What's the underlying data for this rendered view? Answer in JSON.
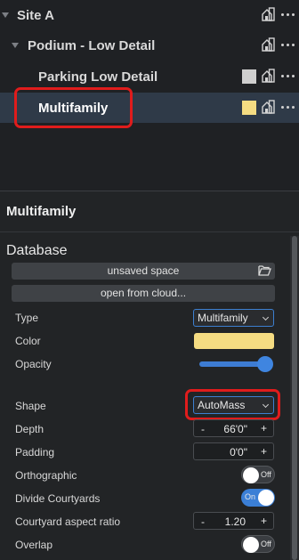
{
  "tree": {
    "items": [
      {
        "label": "Site A",
        "level": 0,
        "expanded": true,
        "swatch": null,
        "selected": false
      },
      {
        "label": "Podium - Low Detail",
        "level": 1,
        "expanded": true,
        "swatch": null,
        "selected": false
      },
      {
        "label": "Parking Low Detail",
        "level": 2,
        "swatch": "#cfcfcf",
        "selected": false
      },
      {
        "label": "Multifamily",
        "level": 2,
        "swatch": "#f5dc82",
        "selected": true
      }
    ]
  },
  "panel": {
    "title": "Multifamily",
    "section": "Database",
    "unsaved_space_label": "unsaved space",
    "open_from_cloud_label": "open from cloud...",
    "type": {
      "label": "Type",
      "value": "Multifamily"
    },
    "color": {
      "label": "Color",
      "value": "#f5dc82"
    },
    "opacity": {
      "label": "Opacity",
      "value": 1.0
    },
    "shape": {
      "label": "Shape",
      "value": "AutoMass"
    },
    "depth": {
      "label": "Depth",
      "value": "66'0\"",
      "minus": "-",
      "plus": "+"
    },
    "padding": {
      "label": "Padding",
      "value": "0'0\"",
      "plus": "+"
    },
    "orthographic": {
      "label": "Orthographic",
      "state": "Off"
    },
    "divide_courtyards": {
      "label": "Divide Courtyards",
      "state": "On"
    },
    "courtyard_aspect_ratio": {
      "label": "Courtyard aspect ratio",
      "value": "1.20",
      "minus": "-",
      "plus": "+"
    },
    "overlap": {
      "label": "Overlap",
      "state": "Off"
    }
  },
  "colors": {
    "accent": "#3b7fd6",
    "highlight": "#e01c1c",
    "selected_row": "#2f3a48"
  }
}
